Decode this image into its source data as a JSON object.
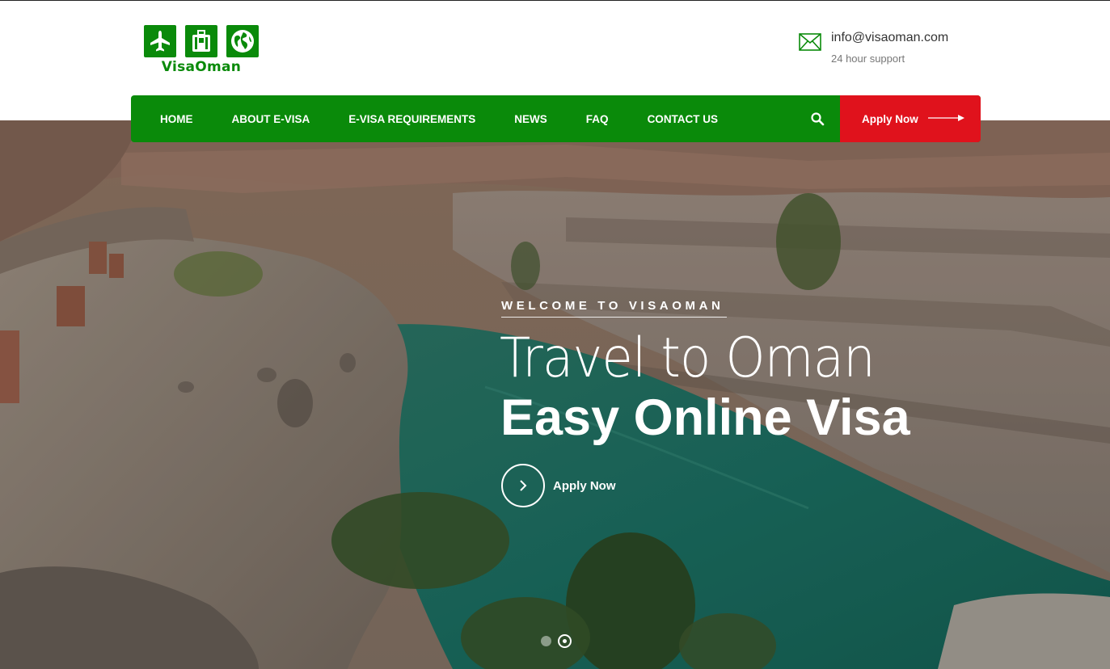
{
  "brand": {
    "name": "VisaOman",
    "logo_icons": [
      "airplane-icon",
      "suitcase-icon",
      "globe-icon"
    ],
    "color": "#0a8a0a"
  },
  "contact": {
    "icon": "envelope-icon",
    "email": "info@visaoman.com",
    "support": "24 hour support"
  },
  "nav": {
    "items": [
      "HOME",
      "ABOUT E-VISA",
      "E-VISA REQUIREMENTS",
      "NEWS",
      "FAQ",
      "CONTACT US"
    ],
    "search_icon": "search-icon",
    "apply_label": "Apply Now",
    "apply_icon": "arrow-right-icon",
    "background": "#0a8a0a",
    "apply_background": "#e0121c"
  },
  "hero": {
    "kicker": "WELCOME TO VISAOMAN",
    "title_line1": "Travel to Oman",
    "title_line2": "Easy Online Visa",
    "cta_label": "Apply Now",
    "cta_icon": "chevron-right-icon",
    "slides_total": 2,
    "active_slide": 2
  }
}
